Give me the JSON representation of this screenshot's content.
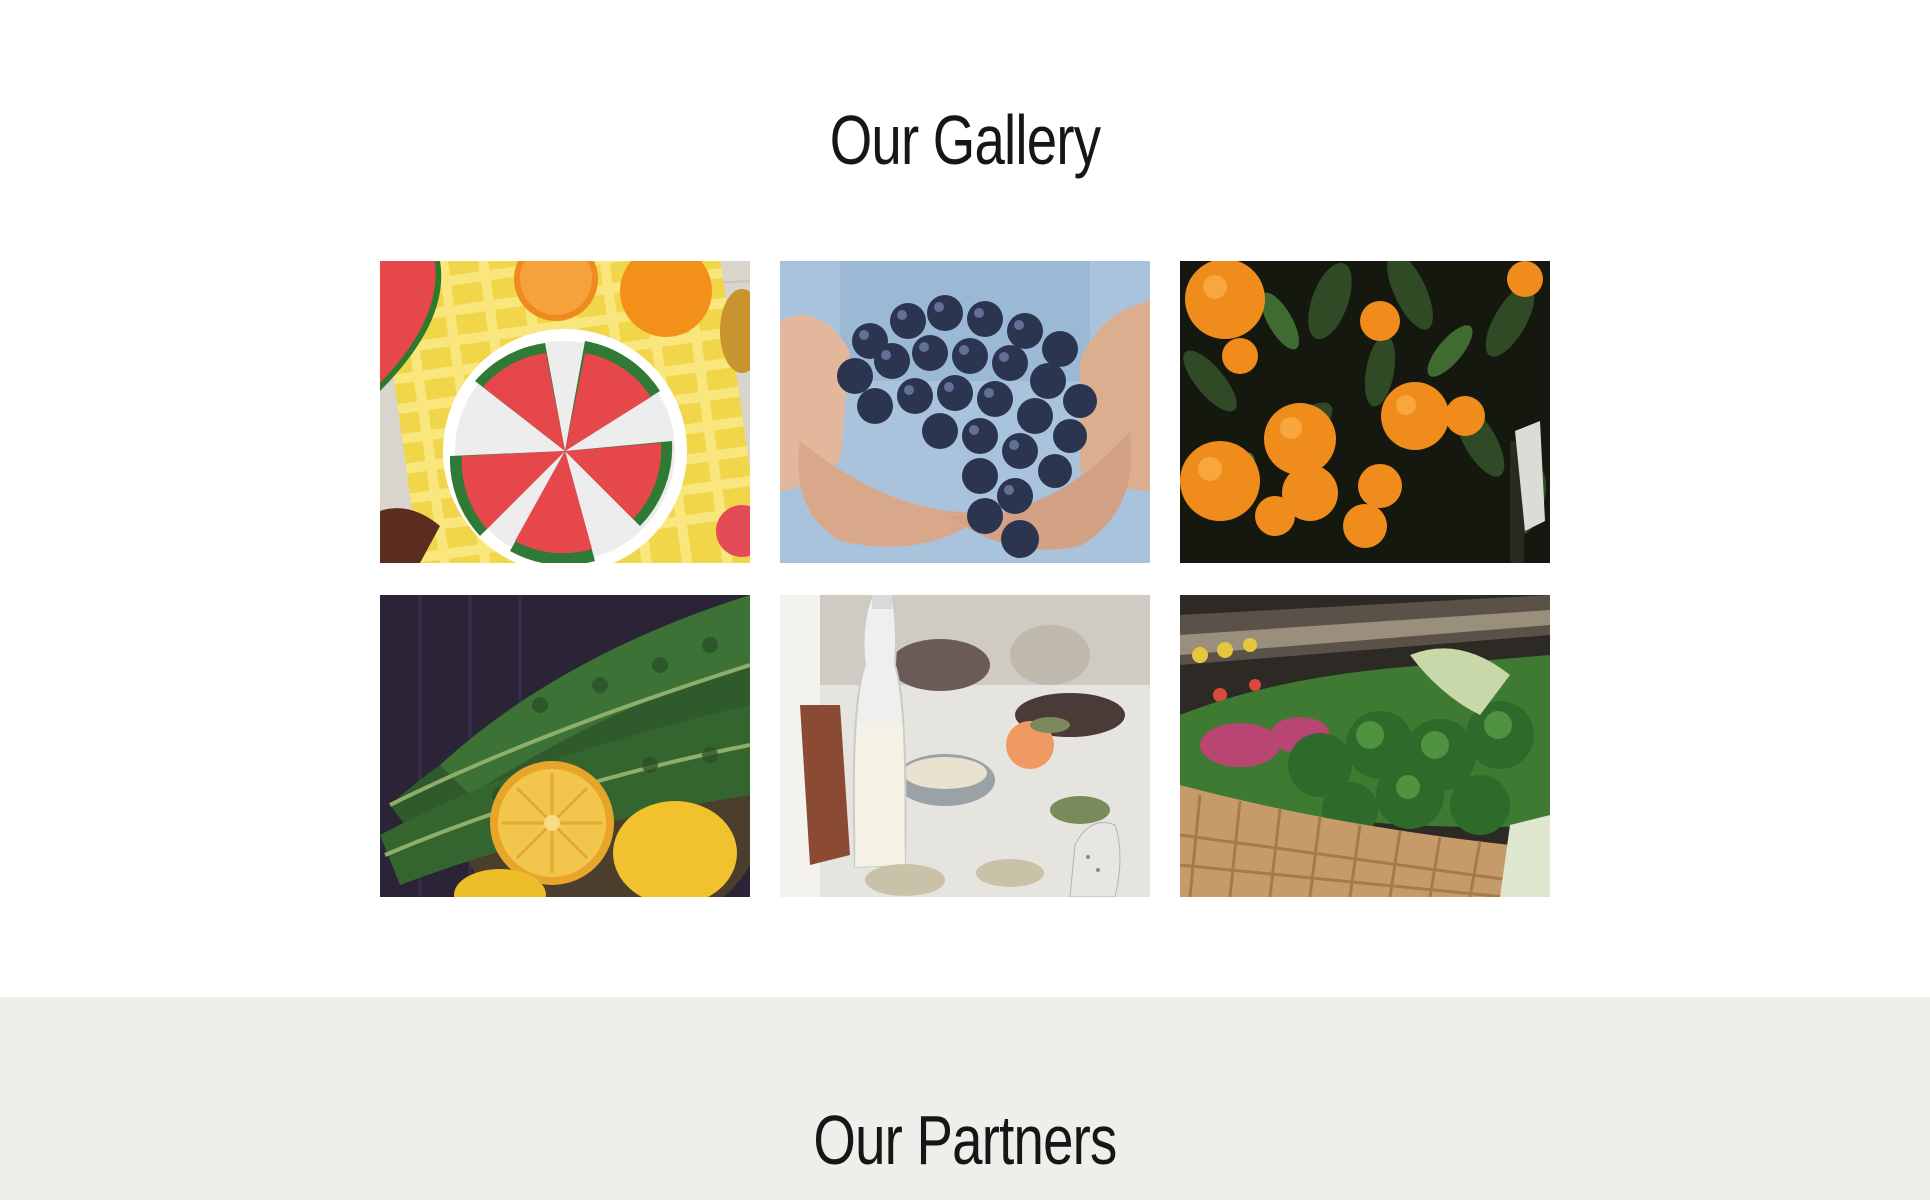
{
  "gallery": {
    "title": "Our Gallery",
    "images": [
      {
        "subject": "watermelon popsicles on a plate with oranges"
      },
      {
        "subject": "hands holding dark grapes"
      },
      {
        "subject": "oranges on a tree"
      },
      {
        "subject": "kale leaves with sliced lemons"
      },
      {
        "subject": "milk bottle on a breakfast table"
      },
      {
        "subject": "leafy greens in market baskets"
      }
    ]
  },
  "partners": {
    "title": "Our Partners"
  },
  "colors": {
    "page_background": "#ffffff",
    "partners_background": "#efeeeb",
    "heading_text": "#161616"
  }
}
